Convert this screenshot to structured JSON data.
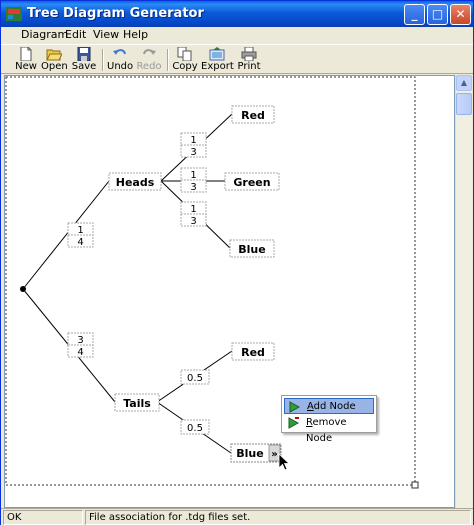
{
  "window": {
    "title": "Tree Diagram Generator"
  },
  "titlebar_buttons": {
    "minimize": "_",
    "maximize": "□",
    "close": "✕"
  },
  "menu": {
    "items": [
      "Diagram",
      "Edit",
      "View",
      "Help"
    ]
  },
  "toolbar": {
    "new": "New",
    "open": "Open",
    "save": "Save",
    "undo": "Undo",
    "redo": "Redo",
    "copy": "Copy",
    "export": "Export",
    "print": "Print"
  },
  "diagram": {
    "nodes": {
      "heads": "Heads",
      "tails": "Tails",
      "red1": "Red",
      "green": "Green",
      "blue1": "Blue",
      "red2": "Red",
      "blue2": "Blue"
    },
    "probabilities": {
      "root_heads": {
        "num": "1",
        "den": "4"
      },
      "root_tails": {
        "num": "3",
        "den": "4"
      },
      "heads_red": {
        "num": "1",
        "den": "3"
      },
      "heads_green": {
        "num": "1",
        "den": "3"
      },
      "heads_blue": {
        "num": "1",
        "den": "3"
      },
      "tails_red": "0.5",
      "tails_blue": "0.5"
    },
    "expander": "»"
  },
  "context_menu": {
    "add_node": "Add Node",
    "remove_node": "Remove Node"
  },
  "statusbar": {
    "state": "OK",
    "message": "File association for .tdg files set."
  },
  "colors": {
    "titlebar": "#0b5ad9",
    "selection": "#98b4e6",
    "canvas": "#ffffff",
    "chrome": "#ece9d8"
  }
}
